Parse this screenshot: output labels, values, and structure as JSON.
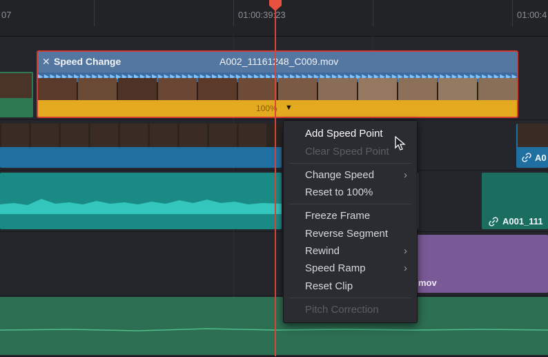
{
  "ruler": {
    "timecode_left": "07",
    "timecode_center": "01:00:39:23",
    "timecode_right": "01:00:4"
  },
  "speed_clip": {
    "close_glyph": "✕",
    "effect_label": "Speed Change",
    "clip_name": "A002_11161248_C009.mov",
    "speed_value": "100%",
    "dropdown_glyph": "▼",
    "arrow_glyphs": "▶▶▶▶▶▶▶▶▶▶▶▶▶▶▶▶▶▶▶▶▶▶▶▶▶▶▶▶▶▶▶▶▶▶▶▶▶▶▶▶▶▶▶▶▶▶▶▶▶▶▶▶▶▶▶▶▶▶▶▶▶▶▶▶▶▶▶▶▶▶▶▶▶▶▶▶▶▶▶▶▶▶▶▶▶▶▶▶▶▶▶▶▶▶▶▶▶▶▶▶▶▶▶▶▶▶▶▶▶▶▶▶▶▶▶▶▶▶▶▶▶▶▶▶▶▶▶▶▶▶▶▶▶▶▶▶▶▶▶▶▶"
  },
  "video_track": {
    "right_clip_label": "A0"
  },
  "audio_track": {
    "right_clip_label": "A001_111"
  },
  "purple_clip": {
    "label": "mov"
  },
  "context_menu": {
    "items": [
      {
        "label": "Add Speed Point",
        "enabled": true,
        "submenu": false
      },
      {
        "label": "Clear Speed Point",
        "enabled": false,
        "submenu": false
      },
      {
        "label": "Change Speed",
        "enabled": true,
        "submenu": true
      },
      {
        "label": "Reset to 100%",
        "enabled": true,
        "submenu": false
      },
      {
        "label": "Freeze Frame",
        "enabled": true,
        "submenu": false
      },
      {
        "label": "Reverse Segment",
        "enabled": true,
        "submenu": false
      },
      {
        "label": "Rewind",
        "enabled": true,
        "submenu": true
      },
      {
        "label": "Speed Ramp",
        "enabled": true,
        "submenu": true
      },
      {
        "label": "Reset Clip",
        "enabled": true,
        "submenu": false
      },
      {
        "label": "Pitch Correction",
        "enabled": false,
        "submenu": false
      }
    ],
    "chevron": "›"
  },
  "colors": {
    "speed_header": "#5377a0",
    "speed_bar": "#e3a91f",
    "selection_border": "#d43b33",
    "playhead": "#d8453a",
    "video_clip": "#1f6fa0",
    "audio_clip": "#1a8a84"
  },
  "icons": {
    "playhead": "playhead-marker-icon",
    "link": "link-icon",
    "cursor": "mouse-pointer-icon"
  }
}
